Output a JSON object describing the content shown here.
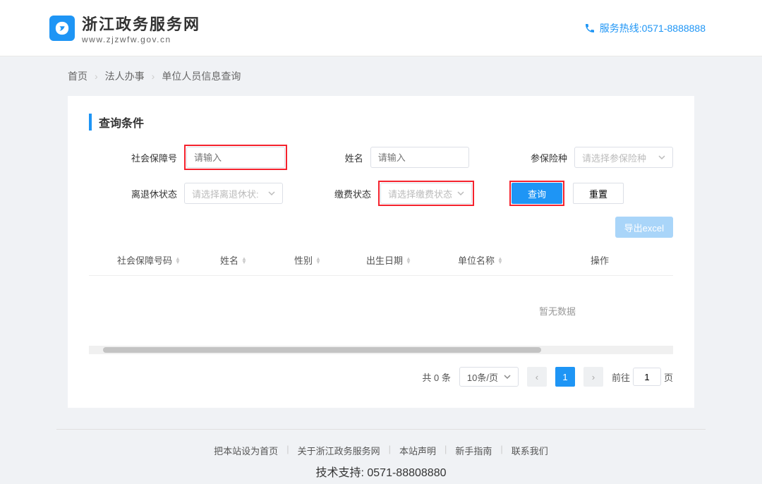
{
  "header": {
    "title": "浙江政务服务网",
    "url": "www.zjzwfw.gov.cn",
    "hotline_label": "服务热线:0571-8888888"
  },
  "breadcrumb": {
    "items": [
      "首页",
      "法人办事",
      "单位人员信息查询"
    ]
  },
  "search": {
    "section_title": "查询条件",
    "fields": {
      "ssn": {
        "label": "社会保障号",
        "placeholder": "请输入"
      },
      "name": {
        "label": "姓名",
        "placeholder": "请输入"
      },
      "ins_type": {
        "label": "参保险种",
        "placeholder": "请选择参保险种"
      },
      "retire_status": {
        "label": "离退休状态",
        "placeholder": "请选择离退休状:"
      },
      "pay_status": {
        "label": "缴费状态",
        "placeholder": "请选择缴费状态"
      }
    },
    "buttons": {
      "query": "查询",
      "reset": "重置"
    }
  },
  "table": {
    "export_label": "导出excel",
    "columns": [
      "社会保障号码",
      "姓名",
      "性别",
      "出生日期",
      "单位名称",
      "操作"
    ],
    "empty_text": "暂无数据"
  },
  "pagination": {
    "total_text": "共 0 条",
    "page_size_label": "10条/页",
    "current": "1",
    "goto_prefix": "前往",
    "goto_value": "1",
    "goto_suffix": "页"
  },
  "footer": {
    "links": [
      "把本站设为首页",
      "关于浙江政务服务网",
      "本站声明",
      "新手指南",
      "联系我们"
    ],
    "support": "技术支持: 0571-88808880"
  }
}
